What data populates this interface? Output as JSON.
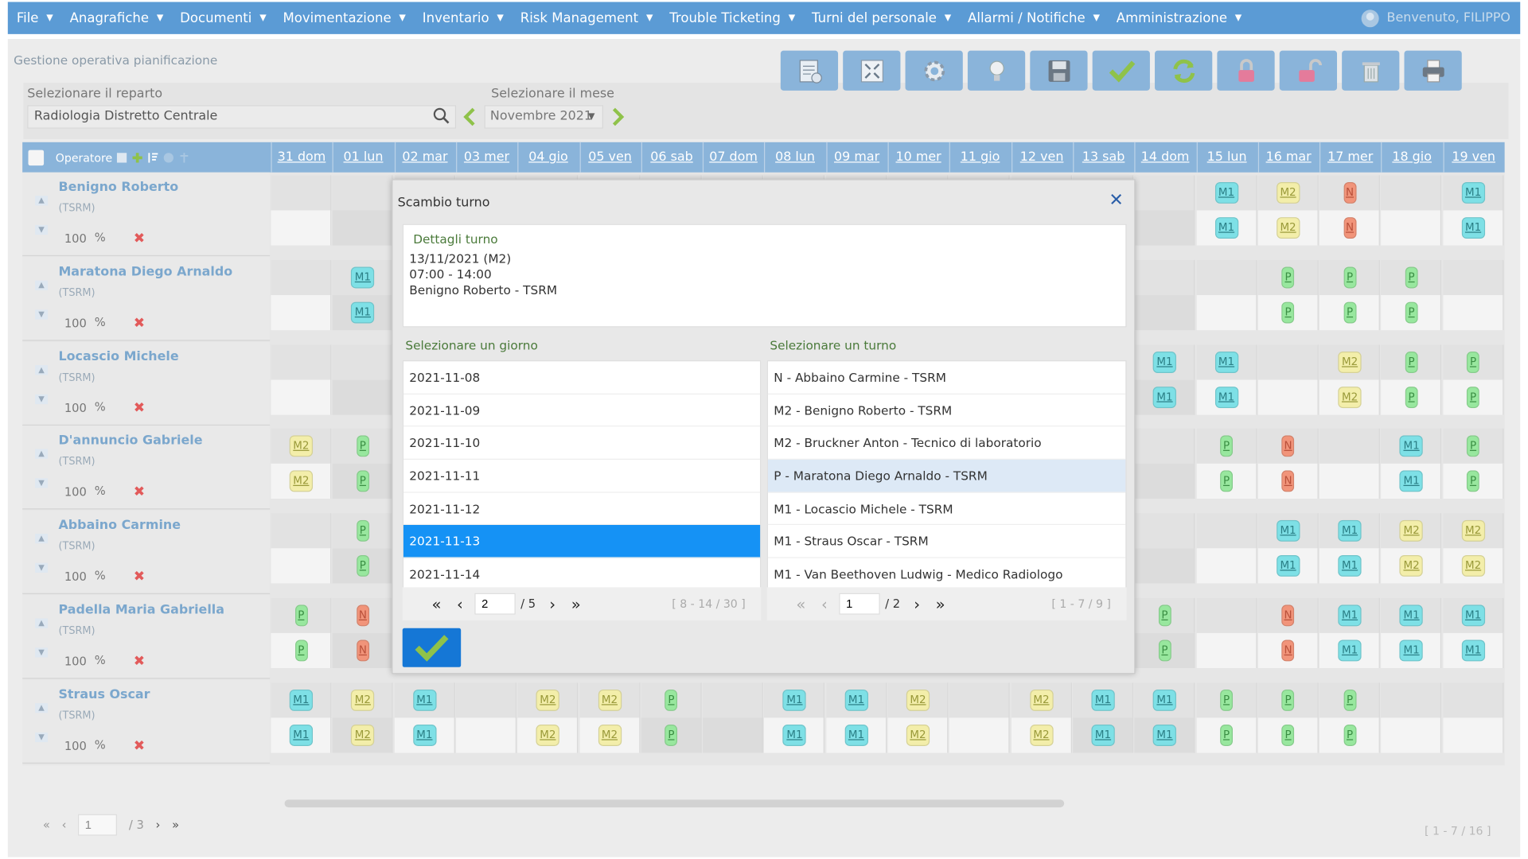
{
  "menu": [
    {
      "label": "File"
    },
    {
      "label": "Anagrafiche"
    },
    {
      "label": "Documenti"
    },
    {
      "label": "Movimentazione"
    },
    {
      "label": "Inventario"
    },
    {
      "label": "Risk Management"
    },
    {
      "label": "Trouble Ticketing"
    },
    {
      "label": "Turni del personale"
    },
    {
      "label": "Allarmi / Notifiche"
    },
    {
      "label": "Amministrazione"
    }
  ],
  "user": {
    "greeting": "Benvenuto, FILIPPO"
  },
  "page": {
    "title": "Gestione operativa pianificazione"
  },
  "filters": {
    "reparto_label": "Selezionare il reparto",
    "reparto_value": "Radiologia Distretto Centrale",
    "mese_label": "Selezionare il mese",
    "mese_value": "Novembre 2021"
  },
  "toolbar": {
    "buttons": [
      "list-edit-icon",
      "collapse-icon",
      "gear-icon",
      "lightbulb-icon",
      "save-icon",
      "check-icon",
      "refresh-icon",
      "lock-icon",
      "unlock-icon",
      "trash-icon",
      "print-icon"
    ]
  },
  "grid": {
    "operator_header": "Operatore",
    "days": [
      "31 dom",
      "01 lun",
      "02 mar",
      "03 mer",
      "04 gio",
      "05 ven",
      "06 sab",
      "07 dom",
      "08 lun",
      "09 mar",
      "10 mer",
      "11 gio",
      "12 ven",
      "13 sab",
      "14 dom",
      "15 lun",
      "16 mar",
      "17 mer",
      "18 gio",
      "19 ven"
    ],
    "operators": [
      {
        "name": "Benigno Roberto",
        "role": "(TSRM)",
        "pct": "100",
        "shifts": {
          "15": "M1",
          "16": "M2",
          "17": "N",
          "19": "M1"
        }
      },
      {
        "name": "Maratona Diego Arnaldo",
        "role": "(TSRM)",
        "pct": "100",
        "shifts": {
          "1": "M1",
          "16": "P",
          "17": "P",
          "18": "P"
        }
      },
      {
        "name": "Locascio Michele",
        "role": "(TSRM)",
        "pct": "100",
        "shifts": {
          "14": "M1",
          "15": "M1",
          "17": "M2",
          "18": "P",
          "19": "P"
        }
      },
      {
        "name": "D'annuncio Gabriele",
        "role": "(TSRM)",
        "pct": "100",
        "shifts": {
          "0": "M2",
          "1": "P",
          "15": "P",
          "16": "N",
          "18": "M1",
          "19": "P"
        }
      },
      {
        "name": "Abbaino Carmine",
        "role": "(TSRM)",
        "pct": "100",
        "shifts": {
          "1": "P",
          "16": "M1",
          "17": "M1",
          "18": "M2",
          "19": "M2"
        }
      },
      {
        "name": "Padella Maria Gabriella",
        "role": "(TSRM)",
        "pct": "100",
        "shifts": {
          "0": "P",
          "1": "N",
          "14": "P",
          "16": "N",
          "17": "M1",
          "18": "M1",
          "19": "M1"
        }
      },
      {
        "name": "Straus Oscar",
        "role": "(TSRM)",
        "pct": "100",
        "shifts": {
          "0": "M1",
          "1": "M2",
          "2": "M1",
          "4": "M2",
          "5": "M2",
          "6": "P",
          "8": "M1",
          "9": "M1",
          "10": "M2",
          "12": "M2",
          "13": "M1",
          "14": "M1",
          "15": "P",
          "16": "P",
          "17": "P"
        }
      }
    ],
    "pager": {
      "page": "1",
      "total": "/ 3",
      "summary": "[ 1 - 7 / 16 ]"
    }
  },
  "modal": {
    "title": "Scambio turno",
    "details_label": "Dettagli turno",
    "details_lines": [
      "13/11/2021 (M2)",
      "07:00 - 14:00",
      "Benigno Roberto - TSRM"
    ],
    "day_label": "Selezionare un giorno",
    "days": [
      "2021-11-08",
      "2021-11-09",
      "2021-11-10",
      "2021-11-11",
      "2021-11-12",
      "2021-11-13",
      "2021-11-14"
    ],
    "selected_day_index": 5,
    "day_pager": {
      "page": "2",
      "total": "/ 5",
      "summary": "[ 8 - 14 / 30 ]"
    },
    "shift_label": "Selezionare un turno",
    "shifts": [
      "N - Abbaino Carmine - TSRM",
      "M2 - Benigno Roberto - TSRM",
      "M2 - Bruckner Anton - Tecnico di laboratorio",
      "P - Maratona Diego Arnaldo - TSRM",
      "M1 - Locascio Michele - TSRM",
      "M1 - Straus Oscar - TSRM",
      "M1 - Van Beethoven Ludwig - Medico Radiologo"
    ],
    "highlighted_shift_index": 3,
    "shift_pager": {
      "page": "1",
      "total": "/ 2",
      "summary": "[ 1 - 7 / 9 ]"
    }
  },
  "colors": {
    "menubar": "#5b9bd5",
    "toolbar_button": "#8ab4da",
    "selected_row": "#1592f5",
    "confirm": "#1577d6"
  }
}
